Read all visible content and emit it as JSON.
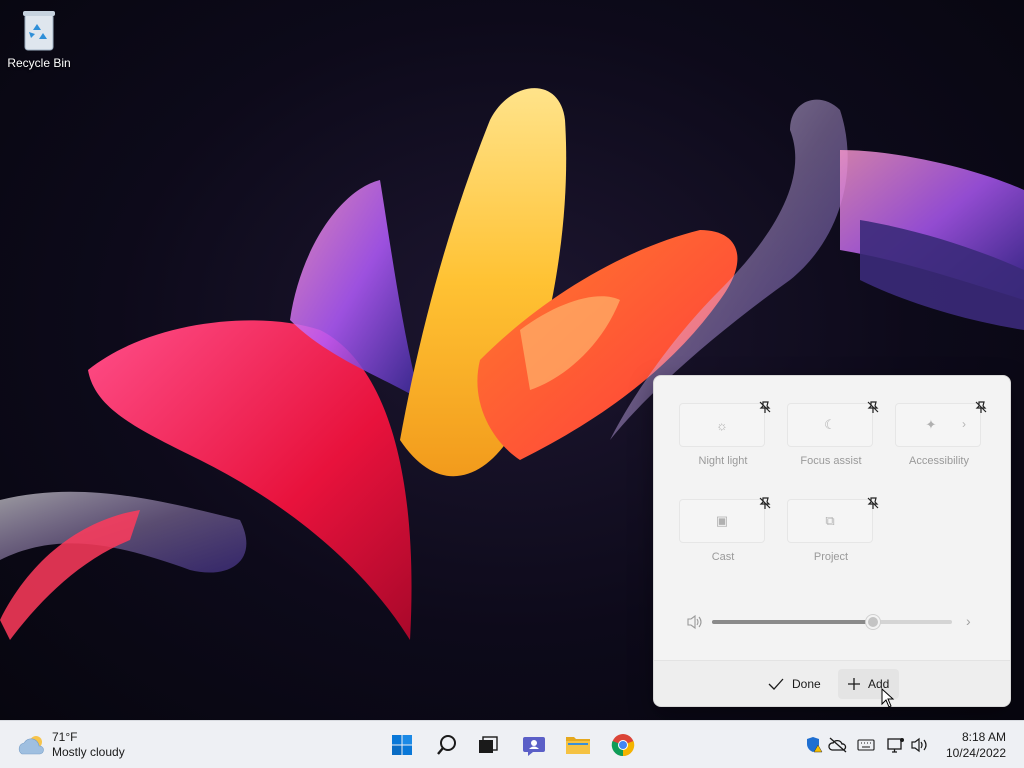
{
  "desktop": {
    "icons": [
      {
        "label": "Recycle Bin",
        "icon": "recycle-bin-icon"
      }
    ]
  },
  "quick_settings": {
    "mode": "edit",
    "tiles": [
      {
        "label": "Night light",
        "icon": "sun-icon",
        "pinned": true
      },
      {
        "label": "Focus assist",
        "icon": "moon-icon",
        "pinned": true
      },
      {
        "label": "Accessibility",
        "icon": "accessibility-icon",
        "pinned": true,
        "has_chevron": true
      },
      {
        "label": "Cast",
        "icon": "cast-icon",
        "pinned": true
      },
      {
        "label": "Project",
        "icon": "project-icon",
        "pinned": true
      }
    ],
    "volume": {
      "icon": "speaker-icon",
      "level": 0.67
    },
    "footer": {
      "done_label": "Done",
      "add_label": "Add"
    }
  },
  "taskbar": {
    "weather": {
      "temperature": "71°F",
      "condition": "Mostly cloudy",
      "icon": "cloud-sun-icon"
    },
    "apps": [
      {
        "name": "Start",
        "icon": "windows-logo-icon"
      },
      {
        "name": "Search",
        "icon": "search-icon"
      },
      {
        "name": "Task View",
        "icon": "task-view-icon"
      },
      {
        "name": "Chat",
        "icon": "teams-chat-icon"
      },
      {
        "name": "File Explorer",
        "icon": "folder-icon"
      },
      {
        "name": "Google Chrome",
        "icon": "chrome-icon"
      }
    ],
    "tray": [
      "windows-security-warning-icon",
      "onedrive-offline-icon",
      "keyboard-icon",
      "network-icon",
      "volume-icon"
    ],
    "clock": {
      "time": "8:18 AM",
      "date": "10/24/2022"
    }
  },
  "colors": {
    "taskbar_bg": "#eef0f4",
    "panel_bg": "#f3f3f3",
    "start_blue": "#0078d4",
    "folder_yellow": "#f5c242"
  }
}
